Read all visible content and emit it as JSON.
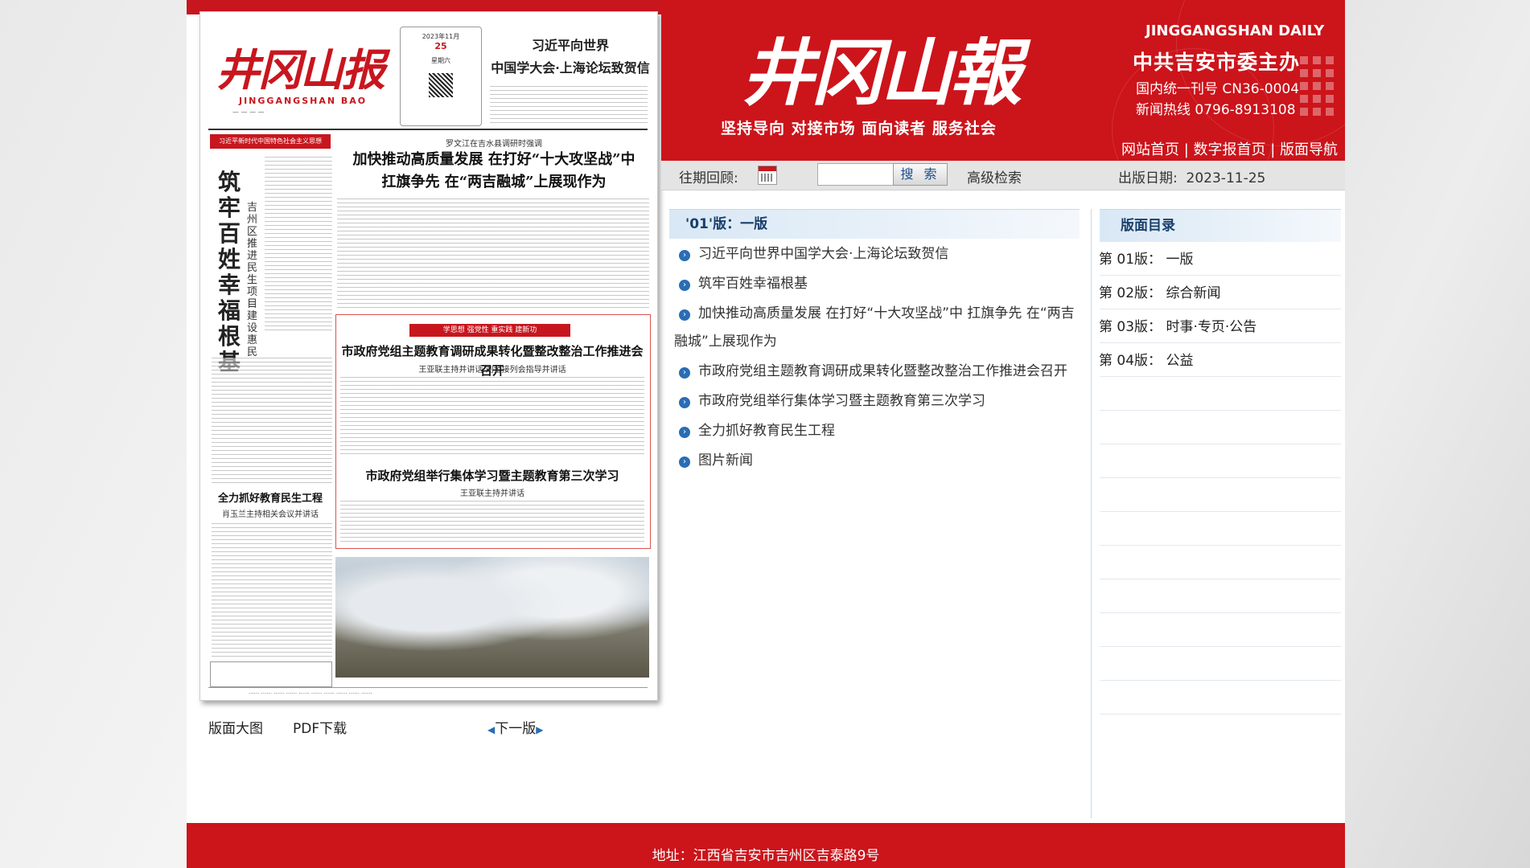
{
  "paper": {
    "masthead": "井冈山报",
    "masthead_en": "JINGGANGSHAN BAO",
    "date_line": "2023年11月",
    "day": "25",
    "weekday": "星期六",
    "headline_top": [
      "习近平向世界",
      "中国学大会·上海论坛致贺信"
    ],
    "kicker": "罗文江在吉水县调研时强调",
    "headline_main": [
      "加快推动高质量发展 在打好“十大攻坚战”中",
      "扛旗争先 在“两吉融城”上展现作为"
    ],
    "vertical_title": "筑牢百姓幸福根基",
    "vertical_sub": "吉州区推进民生项目建设惠民",
    "red_tag": "学思想 强党性 重实践 建新功",
    "headline_3": "市政府党组主题教育调研成果转化暨整改整治工作推进会召开",
    "headline_3_sub": "王亚联主持并讲话  刘金接列会指导并讲话",
    "headline_4": "市政府党组举行集体学习暨主题教育第三次学习",
    "headline_4_sub": "王亚联主持并讲话",
    "headline_5": "全力抓好教育民生工程",
    "headline_5_sub": "肖玉兰主持相关会议并讲话",
    "banner": "习近平新时代中国特色社会主义思想"
  },
  "paper_links": {
    "big_image": "版面大图",
    "pdf": "PDF下载",
    "next": "下一版"
  },
  "header": {
    "logo": "井冈山報",
    "slogan": "坚持导向 对接市场 面向读者 服务社会",
    "english_name": "JINGGANGSHAN DAILY",
    "sponsor": "中共吉安市委主办",
    "issn_line": "国内统一刊号  CN36-0004",
    "hotline_line": "新闻热线  0796-8913108",
    "nav": [
      "网站首页",
      "数字报首页",
      "版面导航"
    ]
  },
  "search": {
    "label": "往期回顾:",
    "input_value": "",
    "button": "搜 索",
    "advanced": "高级检索",
    "date_label": "出版日期:",
    "date_value": "2023-11-25"
  },
  "articles": {
    "header": "'01'版：一版",
    "items": [
      "习近平向世界中国学大会·上海论坛致贺信",
      "筑牢百姓幸福根基",
      "加快推动高质量发展 在打好“十大攻坚战”中 扛旗争先 在“两吉融城”上展现作为",
      "市政府党组主题教育调研成果转化暨整改整治工作推进会召开",
      "市政府党组举行集体学习暨主题教育第三次学习",
      "全力抓好教育民生工程",
      "图片新闻"
    ]
  },
  "toc": {
    "header": "版面目录",
    "items": [
      "第 01版： 一版",
      "第 02版： 综合新闻",
      "第 03版： 时事·专页·公告",
      "第 04版： 公益"
    ]
  },
  "footer": {
    "address": "地址：江西省吉安市吉州区吉泰路9号"
  }
}
